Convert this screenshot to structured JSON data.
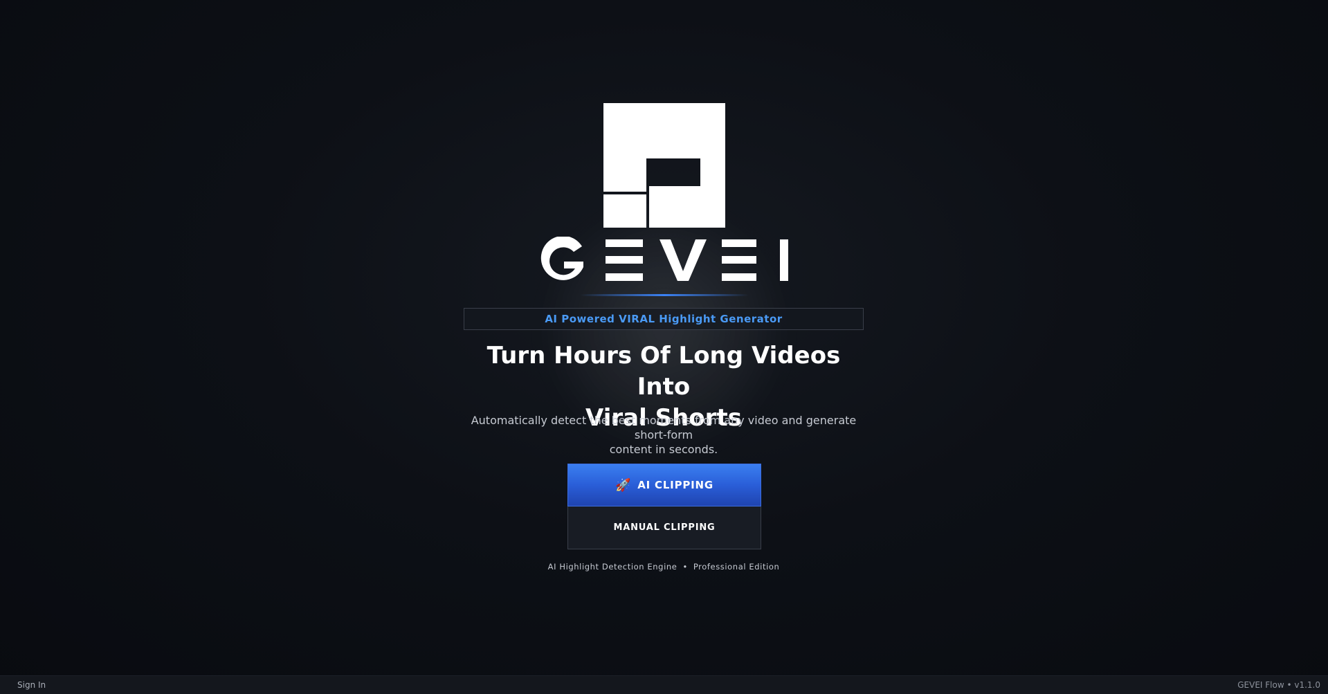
{
  "brand": {
    "wordmark_letters": [
      "G",
      "E",
      "V",
      "E",
      "I"
    ],
    "logo_icon": "geometric-g-logo-icon"
  },
  "hero": {
    "tagline": "AI Powered VIRAL Highlight Generator",
    "headline_line1": "Turn Hours Of Long Videos Into",
    "headline_line2": "Viral Shorts",
    "subtext_line1": "Automatically detect the best moments from any video and generate short-form",
    "subtext_line2": "content in seconds."
  },
  "actions": {
    "ai_clipping_icon": "🚀",
    "ai_clipping_label": "AI CLIPPING",
    "manual_clipping_label": "MANUAL CLIPPING"
  },
  "engine": {
    "left": "AI Highlight Detection Engine",
    "separator": "•",
    "right": "Professional Edition"
  },
  "footer": {
    "sign_in": "Sign In",
    "version": "GEVEI Flow • v1.1.0"
  },
  "colors": {
    "background": "#0b0d12",
    "accent_blue": "#3b82f6",
    "tagline_blue": "#4a9af5",
    "button_blue": "#2a5ed8"
  }
}
